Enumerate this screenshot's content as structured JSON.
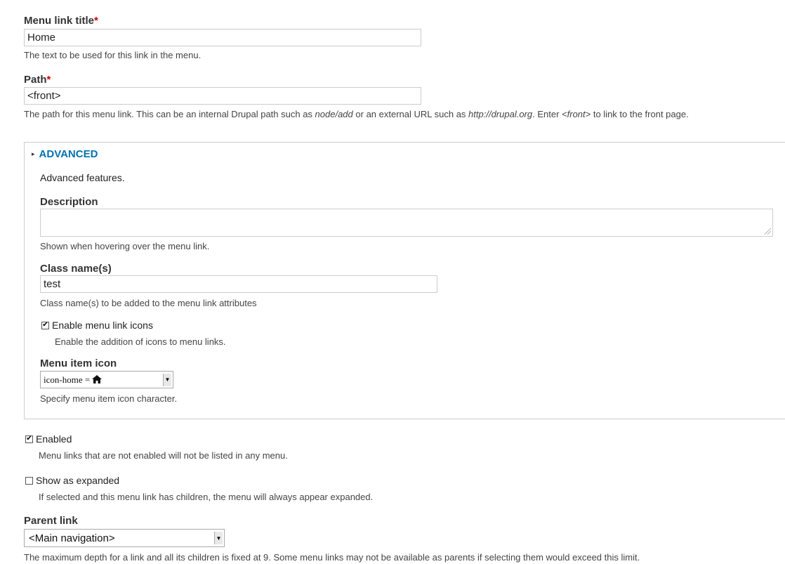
{
  "menu_link_title": {
    "label": "Menu link title",
    "required_mark": "*",
    "value": "Home",
    "description": "The text to be used for this link in the menu."
  },
  "path": {
    "label": "Path",
    "required_mark": "*",
    "value": "<front>",
    "desc_part1": "The path for this menu link. This can be an internal Drupal path such as ",
    "desc_em1": "node/add",
    "desc_part2": " or an external URL such as ",
    "desc_em2": "http://drupal.org",
    "desc_part3": ". Enter ",
    "desc_em3": "<front>",
    "desc_part4": " to link to the front page."
  },
  "advanced": {
    "legend": "ADVANCED",
    "intro": "Advanced features.",
    "description_label": "Description",
    "description_value": "",
    "description_help": "Shown when hovering over the menu link.",
    "class_label": "Class name(s)",
    "class_value": "test",
    "class_help": "Class name(s) to be added to the menu link attributes",
    "icons_checkbox_label": "Enable menu link icons",
    "icons_checkbox_checked": true,
    "icons_help": "Enable the addition of icons to menu links.",
    "icon_label": "Menu item icon",
    "icon_selected": "icon-home = ",
    "icon_glyph": "home-icon",
    "icon_help": "Specify menu item icon character."
  },
  "enabled": {
    "label": "Enabled",
    "checked": true,
    "help": "Menu links that are not enabled will not be listed in any menu."
  },
  "expanded": {
    "label": "Show as expanded",
    "checked": false,
    "help": "If selected and this menu link has children, the menu will always appear expanded."
  },
  "parent_link": {
    "label": "Parent link",
    "selected": "<Main navigation>",
    "help": "The maximum depth for a link and all its children is fixed at 9. Some menu links may not be available as parents if selecting them would exceed this limit."
  },
  "colors": {
    "link": "#0071b3",
    "required": "#cc0000",
    "border": "#cccccc"
  }
}
